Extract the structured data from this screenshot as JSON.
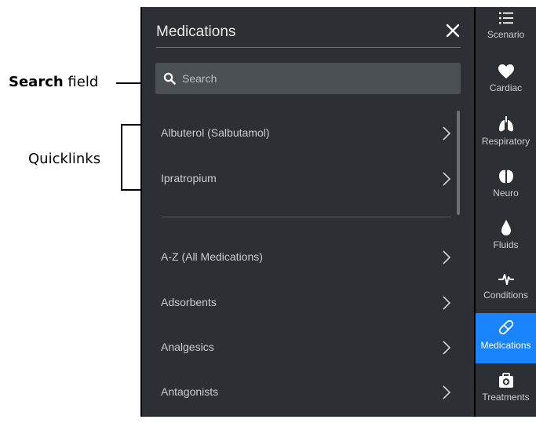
{
  "callouts": {
    "search_bold": "Search",
    "search_rest": " field",
    "quicklinks": "Quicklinks"
  },
  "panel": {
    "title": "Medications",
    "search_placeholder": "Search",
    "quicklinks": [
      {
        "label": "Albuterol (Salbutamol)"
      },
      {
        "label": "Ipratropium"
      }
    ],
    "categories": [
      {
        "label": "A-Z (All Medications)"
      },
      {
        "label": "Adsorbents"
      },
      {
        "label": "Analgesics"
      },
      {
        "label": "Antagonists"
      }
    ]
  },
  "rail": {
    "items": [
      {
        "label": "Scenario",
        "icon": "list-icon"
      },
      {
        "label": "Cardiac",
        "icon": "heart-icon"
      },
      {
        "label": "Respiratory",
        "icon": "lungs-icon"
      },
      {
        "label": "Neuro",
        "icon": "brain-icon"
      },
      {
        "label": "Fluids",
        "icon": "drop-icon"
      },
      {
        "label": "Conditions",
        "icon": "pulse-icon"
      },
      {
        "label": "Medications",
        "icon": "pill-icon",
        "active": true
      },
      {
        "label": "Treatments",
        "icon": "medkit-icon"
      }
    ],
    "active_color": "#1a84ff"
  }
}
